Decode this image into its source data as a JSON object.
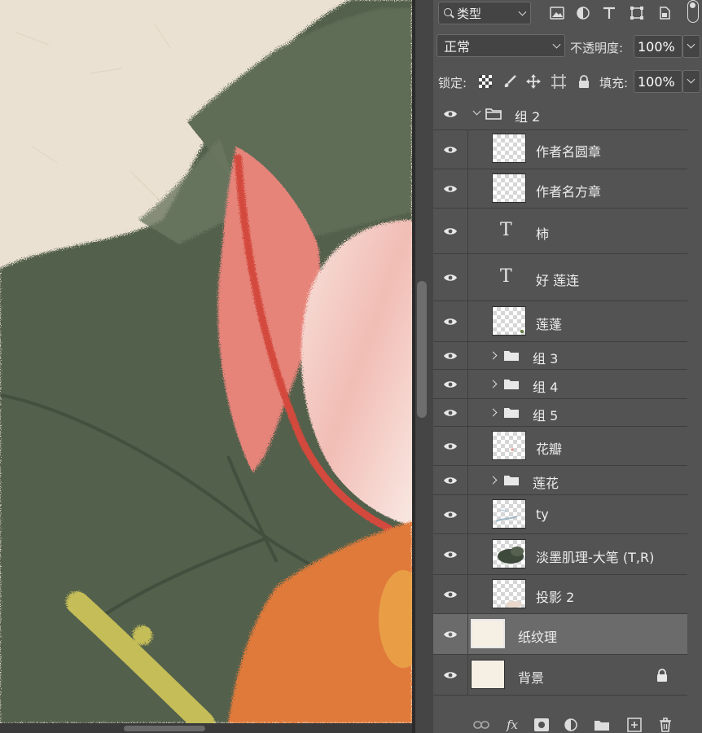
{
  "canvas": {
    "description_name": "artwork-canvas"
  },
  "filter": {
    "label": "类型"
  },
  "blend": {
    "mode": "正常",
    "opacity_label": "不透明度:",
    "opacity_value": "100%"
  },
  "lock": {
    "label": "锁定:",
    "fill_label": "填充:",
    "fill_value": "100%"
  },
  "filter_icons": [
    "image-filter-icon",
    "adjustment-filter-icon",
    "text-filter-icon",
    "shape-filter-icon",
    "smart-object-filter-icon"
  ],
  "layers": [
    {
      "name": "组 2",
      "kind": "group-open"
    },
    {
      "name": "作者名圆章",
      "kind": "pixel"
    },
    {
      "name": "作者名方章",
      "kind": "pixel"
    },
    {
      "name": "柿",
      "kind": "text"
    },
    {
      "name": "好 莲连",
      "kind": "text"
    },
    {
      "name": "莲蓬",
      "kind": "pixel"
    },
    {
      "name": "组 3",
      "kind": "group"
    },
    {
      "name": "组 4",
      "kind": "group"
    },
    {
      "name": "组 5",
      "kind": "group"
    },
    {
      "name": "花瓣",
      "kind": "pixel"
    },
    {
      "name": "莲花",
      "kind": "group"
    },
    {
      "name": "ty",
      "kind": "pixel"
    },
    {
      "name": "淡墨肌理-大笔 (T,R)",
      "kind": "pixel"
    },
    {
      "name": "投影 2",
      "kind": "pixel"
    },
    {
      "name": "纸纹理",
      "kind": "pixel",
      "selected": true
    },
    {
      "name": "背景",
      "kind": "background",
      "locked": true
    }
  ],
  "bottom_icons": {
    "fx": "fx"
  },
  "colors": {
    "panel_bg": "#535353",
    "selected_row": "#6b6b6b",
    "canvas_green": "#4f5e4a",
    "petal_pink": "#e57f70",
    "persimmon_orange": "#e07a3a"
  }
}
